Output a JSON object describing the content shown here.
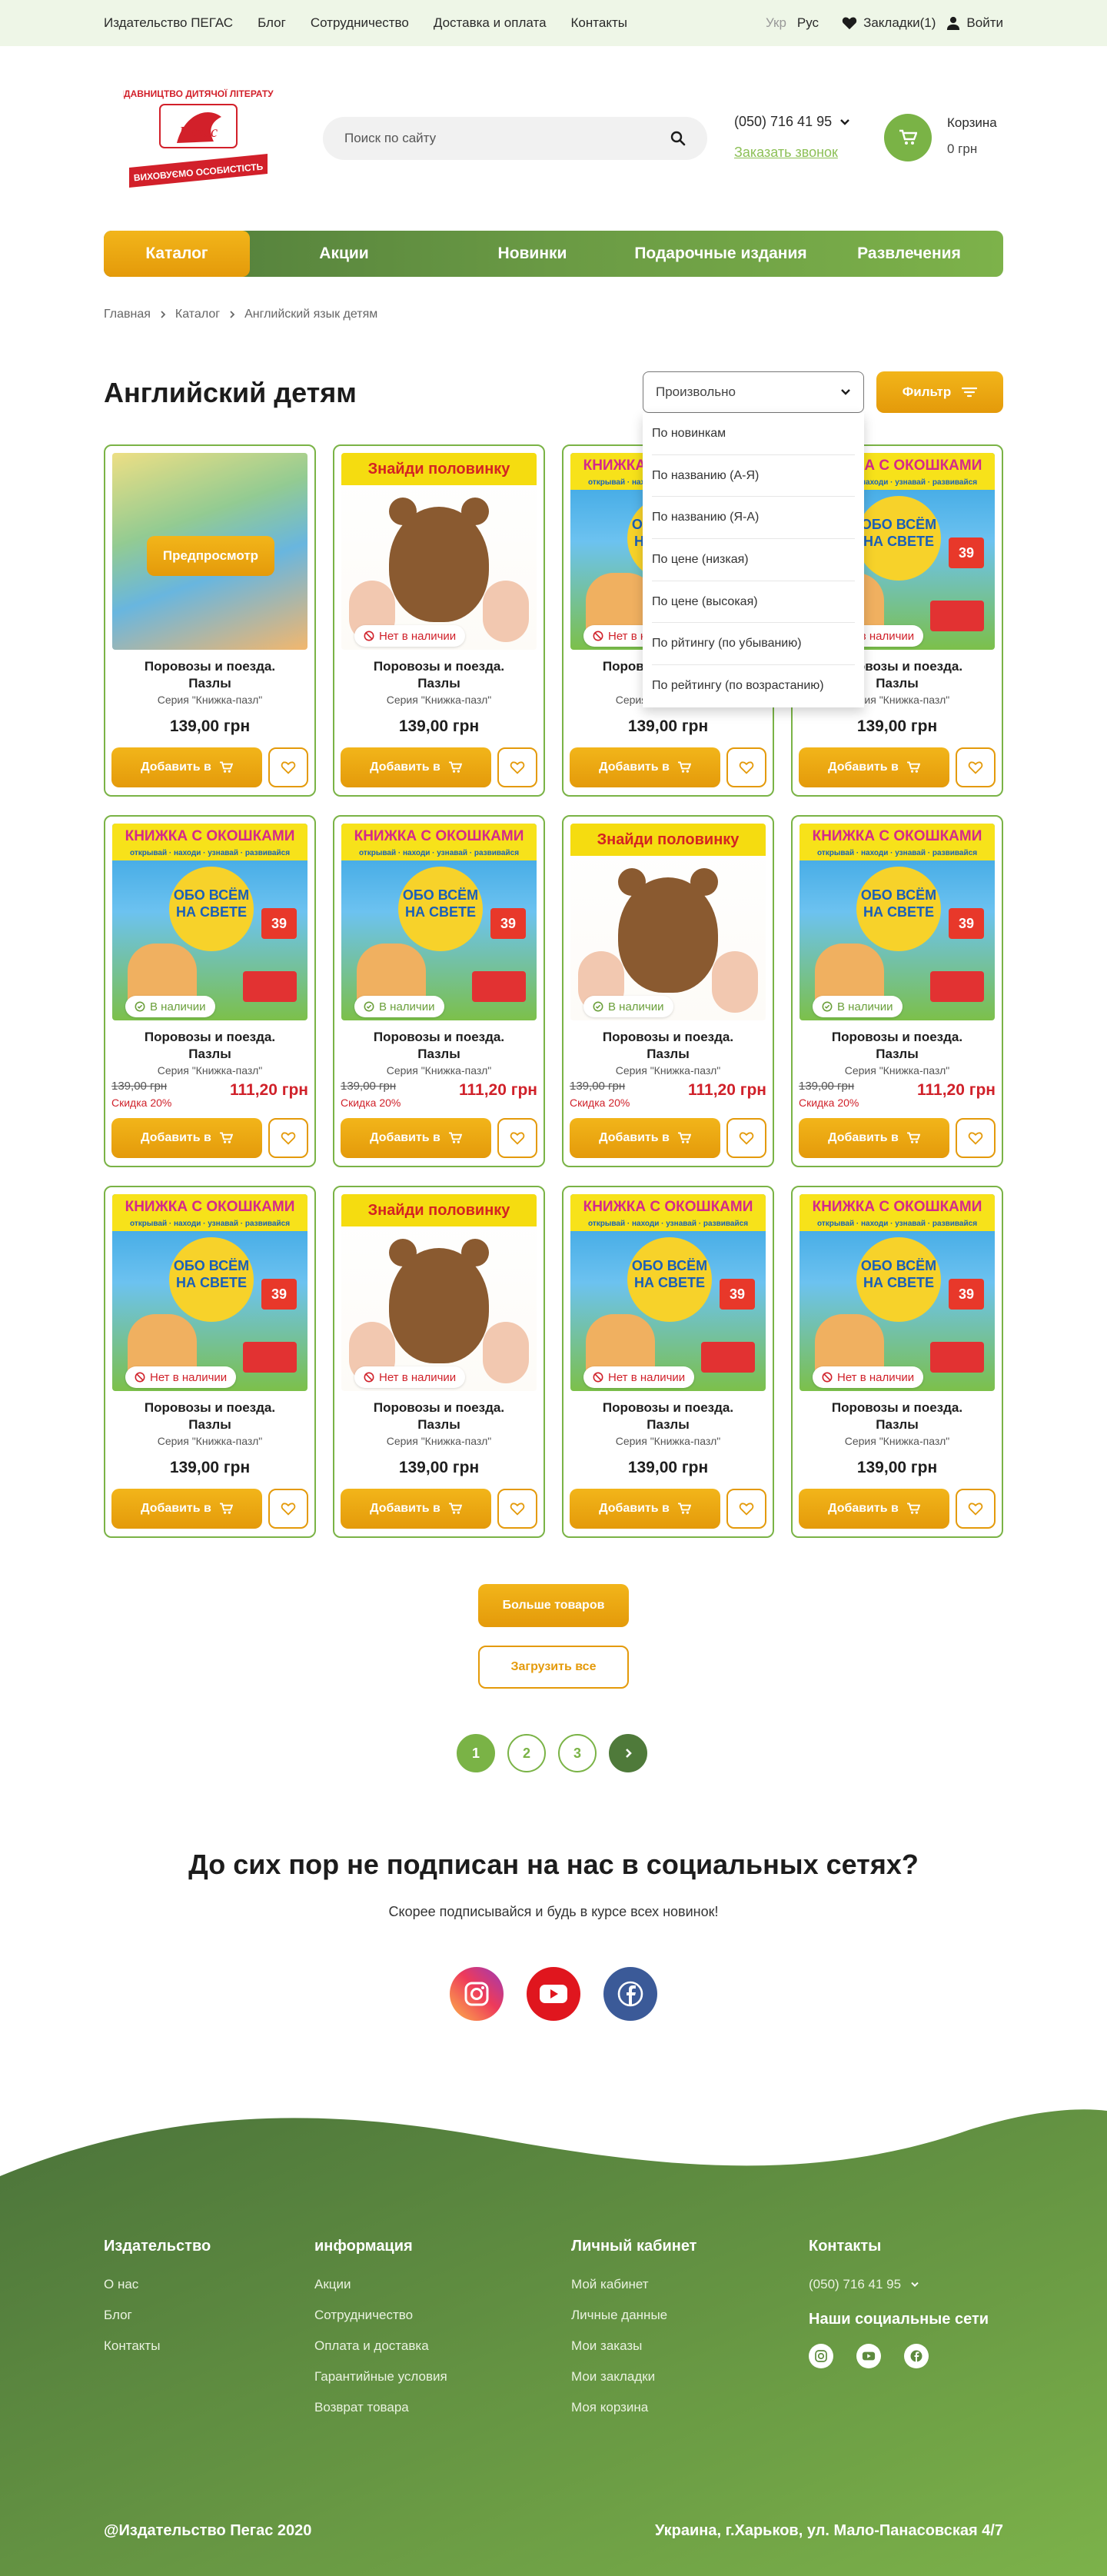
{
  "topnav": {
    "items": [
      "Издательство ПЕГАС",
      "Блог",
      "Сотрудничество",
      "Доставка и оплата",
      "Контакты"
    ],
    "lang_ukr": "Укр",
    "lang_rus": "Рус",
    "bookmarks": "Закладки(1)",
    "login": "Войти"
  },
  "header": {
    "logo_text_top": "ВИДАВНИЦТВО ДИТЯЧОЇ ЛІТЕРАТУРИ",
    "logo_text_mid": "Пегас",
    "logo_text_bottom": "ВИХОВУЄМО ОСОБИСТІСТЬ",
    "search_placeholder": "Поиск по сайту",
    "phone": "(050) 716 41 95",
    "callback": "Заказать звонок",
    "cart_label": "Корзина",
    "cart_sum": "0 грн"
  },
  "mainnav": [
    "Каталог",
    "Акции",
    "Новинки",
    "Подарочные издания",
    "Развлечения"
  ],
  "breadcrumb": [
    "Главная",
    "Каталог",
    "Английский язык детям"
  ],
  "page_title": "Английский детям",
  "sort": {
    "selected": "Произвольно",
    "options": [
      "По новинкам",
      "По названию (А-Я)",
      "По названию (Я-А)",
      "По цене (низкая)",
      "По цене (высокая)",
      "По рйтингу (по убыванию)",
      "По рейтингу (по возрастанию)"
    ]
  },
  "filter_label": "Фильтр",
  "product_common": {
    "title_line1": "Поровозы и поезда.",
    "title_line2": "Пазлы",
    "series": "Серия \"Книжка-пазл\"",
    "add_label": "Добавить в",
    "preview_label": "Предпросмотр"
  },
  "cover_text": {
    "puzzle_band": "Знайди половинку",
    "book_band": "КНИЖКА С ОКОШКАМИ",
    "book_band_sub": "открывай · находи · узнавай · развивайся",
    "book_balloon": "ОБО ВСЁМ НА СВЕТЕ",
    "book_num": "39"
  },
  "products": [
    {
      "cover": "blurred",
      "stock": "",
      "price": "139,00 грн",
      "old_price": "",
      "sale_price": "",
      "discount": "",
      "preview": true
    },
    {
      "cover": "puzzle",
      "stock": "Нет в наличии",
      "stock_type": "out",
      "price": "139,00 грн",
      "old_price": "",
      "sale_price": "",
      "discount": ""
    },
    {
      "cover": "book",
      "stock": "Нет в наличии",
      "stock_type": "out",
      "price": "139,00 грн",
      "old_price": "",
      "sale_price": "",
      "discount": ""
    },
    {
      "cover": "book",
      "stock": "Нет в наличии",
      "stock_type": "out",
      "price": "139,00 грн",
      "old_price": "",
      "sale_price": "",
      "discount": ""
    },
    {
      "cover": "book",
      "stock": "В наличии",
      "stock_type": "in",
      "price": "",
      "old_price": "139,00 грн",
      "sale_price": "111,20 грн",
      "discount": "Скидка 20%"
    },
    {
      "cover": "book",
      "stock": "В наличии",
      "stock_type": "in",
      "price": "",
      "old_price": "139,00 грн",
      "sale_price": "111,20 грн",
      "discount": "Скидка 20%"
    },
    {
      "cover": "puzzle",
      "stock": "В наличии",
      "stock_type": "in",
      "price": "",
      "old_price": "139,00 грн",
      "sale_price": "111,20 грн",
      "discount": "Скидка 20%"
    },
    {
      "cover": "book",
      "stock": "В наличии",
      "stock_type": "in",
      "price": "",
      "old_price": "139,00 грн",
      "sale_price": "111,20 грн",
      "discount": "Скидка 20%"
    },
    {
      "cover": "book",
      "stock": "Нет в наличии",
      "stock_type": "out",
      "price": "139,00 грн",
      "old_price": "",
      "sale_price": "",
      "discount": ""
    },
    {
      "cover": "puzzle",
      "stock": "Нет в наличии",
      "stock_type": "out",
      "price": "139,00 грн",
      "old_price": "",
      "sale_price": "",
      "discount": ""
    },
    {
      "cover": "book",
      "stock": "Нет в наличии",
      "stock_type": "out",
      "price": "139,00 грн",
      "old_price": "",
      "sale_price": "",
      "discount": ""
    },
    {
      "cover": "book",
      "stock": "Нет в наличии",
      "stock_type": "out",
      "price": "139,00 грн",
      "old_price": "",
      "sale_price": "",
      "discount": ""
    }
  ],
  "more_label": "Больше товаров",
  "loadall_label": "Загрузить все",
  "pagination": [
    "1",
    "2",
    "3"
  ],
  "social": {
    "title": "До сих пор не подписан на нас в социальных сетях?",
    "subtitle": "Скорее подписывайся и будь в курсе всех новинок!"
  },
  "footer": {
    "col1": {
      "title": "Издательство",
      "links": [
        "О нас",
        "Блог",
        "Контакты"
      ]
    },
    "col2": {
      "title": "информация",
      "links": [
        "Акции",
        "Сотрудничество",
        "Оплата и доставка",
        "Гарантийные условия",
        "Возврат товара"
      ]
    },
    "col3": {
      "title": "Личный кабинет",
      "links": [
        "Мой кабинет",
        "Личные данные",
        "Мои заказы",
        "Мои закладки",
        "Моя корзина"
      ]
    },
    "col4": {
      "title": "Контакты",
      "phone": "(050) 716 41 95",
      "social_title": "Наши социальные сети"
    },
    "copyright": "@Издательство Пегас 2020",
    "address": "Украина,  г.Харьков, ул. Мало-Панасовская 4/7"
  },
  "colors": {
    "green": "#7ab346",
    "dark_green": "#4f7a3a",
    "orange": "#e49a0a",
    "red": "#d0212a"
  }
}
